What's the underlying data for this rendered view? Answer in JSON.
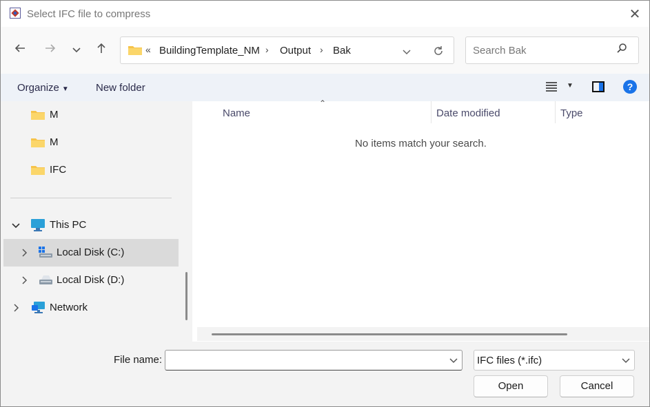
{
  "window": {
    "title": "Select IFC file to compress"
  },
  "nav": {
    "back_icon": "arrow-left-icon",
    "forward_icon": "arrow-right-icon",
    "recent_icon": "chevron-down-icon",
    "up_icon": "arrow-up-icon",
    "overflow": "«",
    "breadcrumbs": [
      "BuildingTemplate_NM",
      "Output",
      "Bak"
    ],
    "search_placeholder": "Search Bak"
  },
  "command_bar": {
    "organize": "Organize",
    "new_folder": "New folder"
  },
  "sidebar": {
    "folders": [
      "M",
      "M",
      "IFC"
    ],
    "this_pc": "This PC",
    "drives": [
      "Local Disk (C:)",
      "Local Disk (D:)"
    ],
    "network": "Network"
  },
  "list": {
    "columns": [
      "Name",
      "Date modified",
      "Type"
    ],
    "empty_message": "No items match your search."
  },
  "footer": {
    "file_name_label": "File name:",
    "file_name_value": "",
    "file_type": "IFC files (*.ifc)",
    "open": "Open",
    "cancel": "Cancel"
  },
  "colors": {
    "accent": "#1a73e8",
    "folder": "#f6c34a",
    "selected": "#dadada"
  }
}
